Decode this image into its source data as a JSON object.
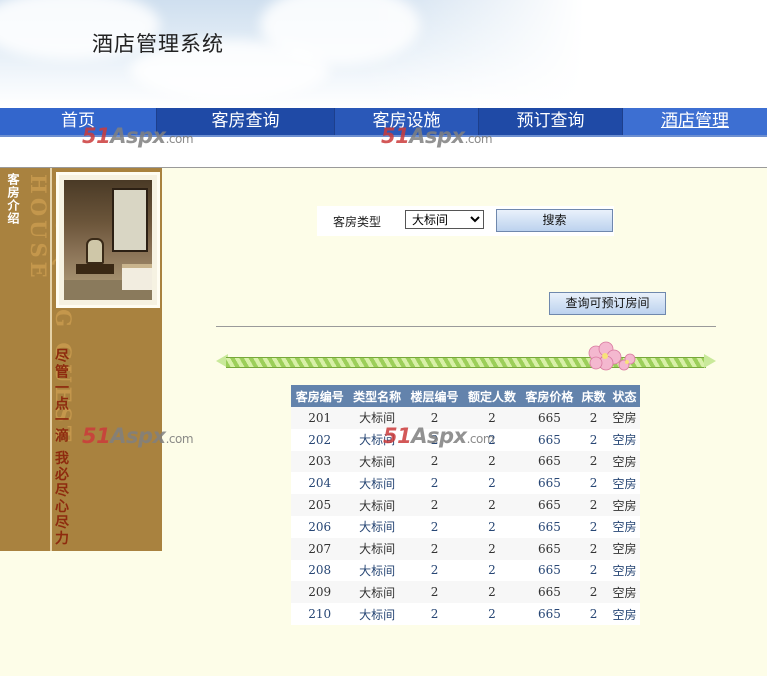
{
  "header": {
    "app_title": "酒店管理系统"
  },
  "nav": {
    "items": [
      {
        "label": "首页"
      },
      {
        "label": "客房查询"
      },
      {
        "label": "客房设施"
      },
      {
        "label": "预订查询"
      },
      {
        "label": "酒店管理"
      }
    ]
  },
  "watermark": {
    "brand_a": "51",
    "brand_b": "Aspx",
    "brand_c": ".com"
  },
  "sidebar": {
    "heading": "客房介绍",
    "vertical_text": "GAO QING GUEST HOUSE",
    "motto": "尽管一点一滴 我必尽心尽力"
  },
  "search": {
    "label": "客房类型",
    "selected": "大标间",
    "options": [
      "大标间"
    ],
    "button_label": "搜索"
  },
  "actions": {
    "available_label": "查询可预订房间"
  },
  "table": {
    "headers": [
      "客房编号",
      "类型名称",
      "楼层编号",
      "额定人数",
      "客房价格",
      "床数",
      "状态"
    ],
    "rows": [
      [
        "201",
        "大标间",
        "2",
        "2",
        "665",
        "2",
        "空房"
      ],
      [
        "202",
        "大标间",
        "2",
        "2",
        "665",
        "2",
        "空房"
      ],
      [
        "203",
        "大标间",
        "2",
        "2",
        "665",
        "2",
        "空房"
      ],
      [
        "204",
        "大标间",
        "2",
        "2",
        "665",
        "2",
        "空房"
      ],
      [
        "205",
        "大标间",
        "2",
        "2",
        "665",
        "2",
        "空房"
      ],
      [
        "206",
        "大标间",
        "2",
        "2",
        "665",
        "2",
        "空房"
      ],
      [
        "207",
        "大标间",
        "2",
        "2",
        "665",
        "2",
        "空房"
      ],
      [
        "208",
        "大标间",
        "2",
        "2",
        "665",
        "2",
        "空房"
      ],
      [
        "209",
        "大标间",
        "2",
        "2",
        "665",
        "2",
        "空房"
      ],
      [
        "210",
        "大标间",
        "2",
        "2",
        "665",
        "2",
        "空房"
      ]
    ]
  },
  "colors": {
    "nav_blue": "#3366cc",
    "sidebar_brown": "#a9823f",
    "table_header": "#6383ac",
    "page_bg": "#fdfde8"
  }
}
